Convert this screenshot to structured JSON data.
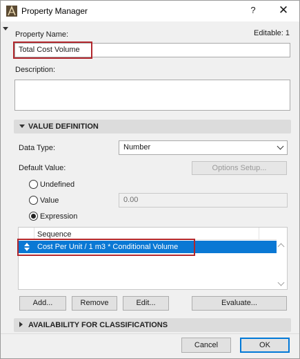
{
  "window": {
    "title": "Property Manager",
    "help_label": "?",
    "close_label": "✕",
    "icon": "archicad-app-icon"
  },
  "property": {
    "name_label": "Property Name:",
    "editable_text": "Editable: 1",
    "name_value": "Total Cost Volume",
    "description_label": "Description:",
    "description_value": ""
  },
  "value_definition": {
    "section_title": "VALUE DEFINITION",
    "data_type_label": "Data Type:",
    "data_type_value": "Number",
    "default_value_label": "Default Value:",
    "options_setup_label": "Options Setup...",
    "options": {
      "undefined_label": "Undefined",
      "value_label": "Value",
      "expression_label": "Expression",
      "selected": "expression"
    },
    "value_input": "0.00"
  },
  "sequence_list": {
    "column_header": "Sequence",
    "rows": [
      {
        "text": "Cost Per Unit / 1 m3 * Conditional Volume",
        "selected": true
      }
    ]
  },
  "list_buttons": {
    "add_label": "Add...",
    "remove_label": "Remove",
    "edit_label": "Edit...",
    "evaluate_label": "Evaluate..."
  },
  "availability": {
    "section_title": "AVAILABILITY FOR CLASSIFICATIONS"
  },
  "footer": {
    "cancel_label": "Cancel",
    "ok_label": "OK"
  },
  "colors": {
    "selection": "#0a78d4",
    "highlight_annotation": "#b1262c",
    "section_bar": "#dcdcdc",
    "primary_button_border": "#0078d7"
  }
}
